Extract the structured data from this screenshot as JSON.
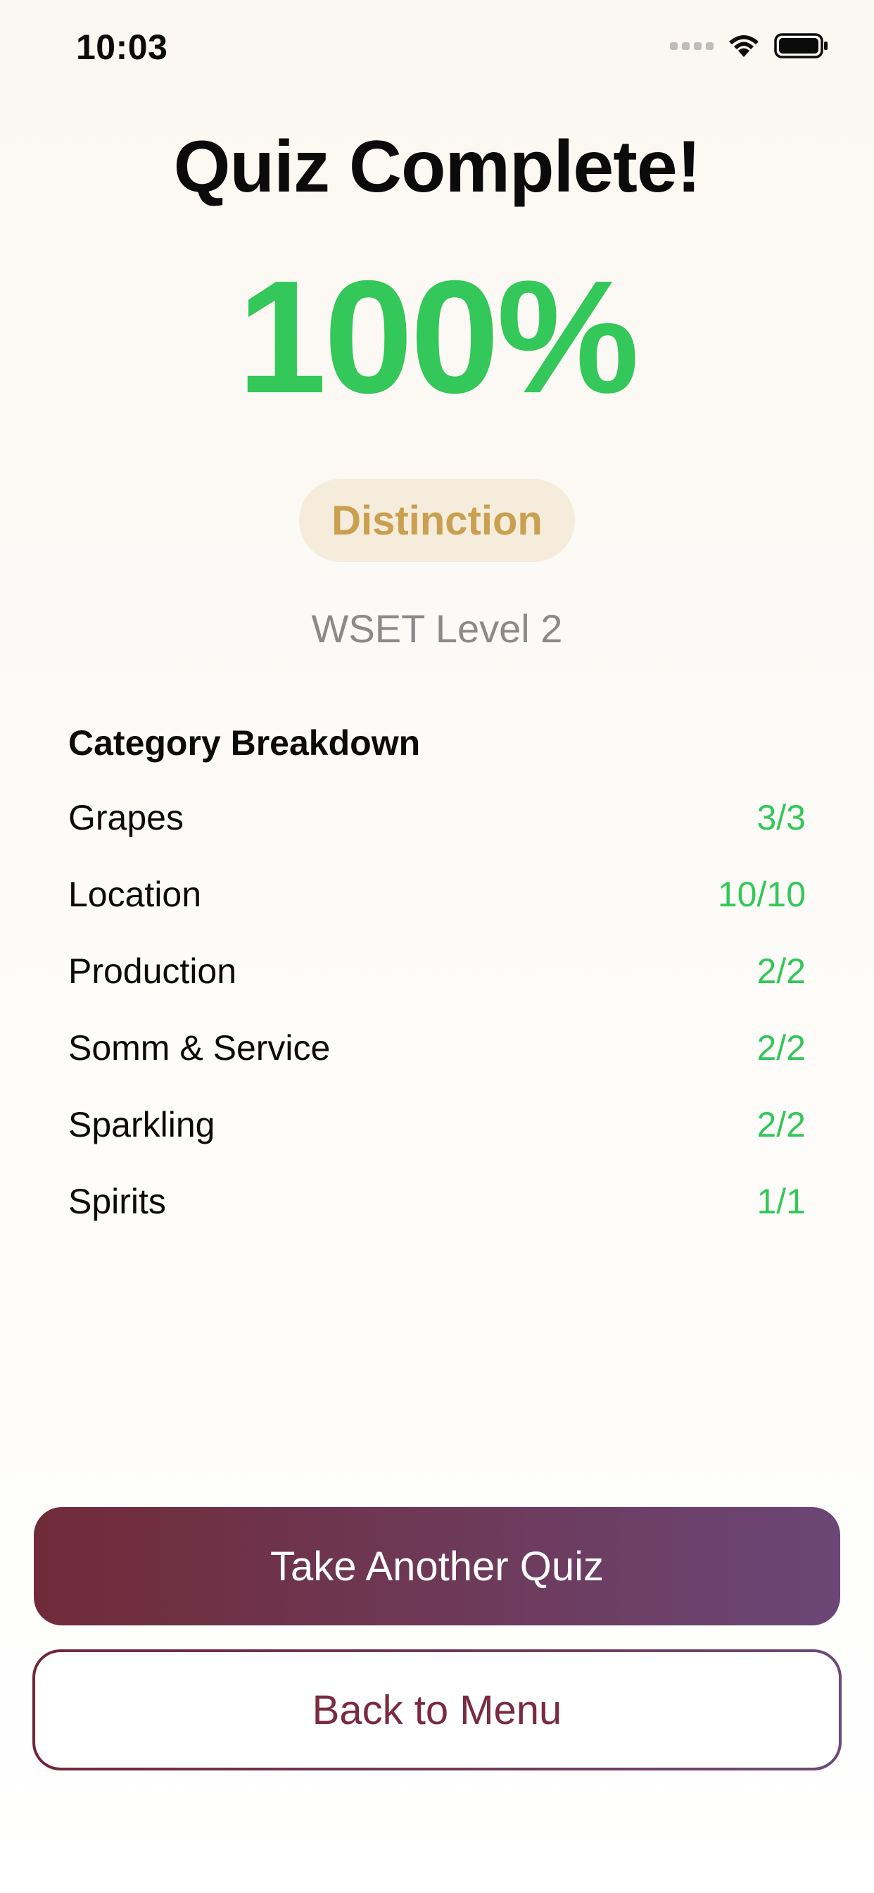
{
  "status_bar": {
    "time": "10:03"
  },
  "title": "Quiz Complete!",
  "score": "100%",
  "badge": "Distinction",
  "level": "WSET Level 2",
  "breakdown": {
    "title": "Category Breakdown",
    "rows": [
      {
        "label": "Grapes",
        "value": "3/3"
      },
      {
        "label": "Location",
        "value": "10/10"
      },
      {
        "label": "Production",
        "value": "2/2"
      },
      {
        "label": "Somm & Service",
        "value": "2/2"
      },
      {
        "label": "Sparkling",
        "value": "2/2"
      },
      {
        "label": "Spirits",
        "value": "1/1"
      }
    ]
  },
  "buttons": {
    "primary": "Take Another Quiz",
    "secondary": "Back to Menu"
  },
  "colors": {
    "success": "#34c759",
    "badge_text": "#c9a04f",
    "badge_bg": "#f6ecdc",
    "brand_start": "#702b38",
    "brand_end": "#6b4676"
  },
  "icons": [
    "cellular-signal-icon",
    "wifi-icon",
    "battery-icon"
  ]
}
